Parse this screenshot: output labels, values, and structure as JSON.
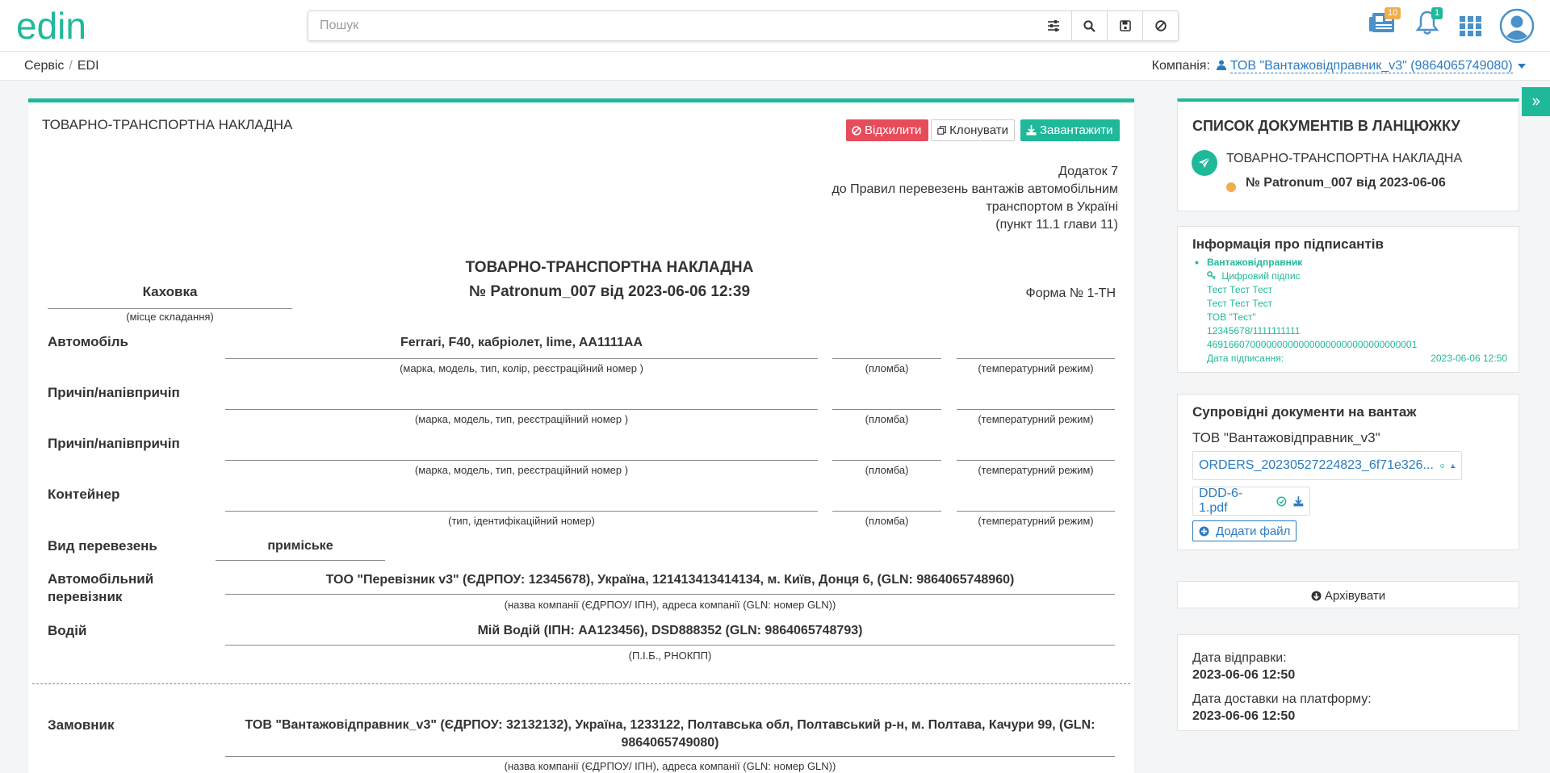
{
  "header": {
    "logo_text": "edin",
    "search_placeholder": "Пошук",
    "news_badge": "10",
    "notif_badge": "1"
  },
  "breadcrumb": [
    "Сервіс",
    "EDI"
  ],
  "company": {
    "label": "Компанія:",
    "name": "ТОВ \"Вантажовідправник_v3\" (9864065749080)"
  },
  "card": {
    "title": "ТОВАРНО-ТРАНСПОРТНА НАКЛАДНА",
    "reject_label": "Відхилити",
    "clone_label": "Клонувати",
    "download_label": "Завантажити"
  },
  "doc": {
    "appendix": [
      "Додаток 7",
      "до Правил перевезень вантажів автомобільним",
      "транспортом в Україні",
      "(пункт 11.1 глави 11)"
    ],
    "title": "ТОВАРНО-ТРАНСПОРТНА НАКЛАДНА",
    "number": "№ Patronum_007 від 2023-06-06 12:39",
    "place": "Каховка",
    "place_caption": "(місце складання)",
    "form_no": "Форма № 1-ТН",
    "car_label": "Автомобіль",
    "car_value": "Ferrari, F40, кабріолет, lime, AA1111AA",
    "car_caption": "(марка, модель, тип, колір, реєстраційний номер )",
    "seal_caption": "(пломба)",
    "temp_caption": "(температурний режим)",
    "trailer_label": "Причіп/напівпричіп",
    "trailer_caption": "(марка, модель, тип, реєстраційний номер )",
    "container_label": "Контейнер",
    "container_caption": "(тип, ідентифікаційний номер)",
    "transport_type_label": "Вид перевезень",
    "transport_type_value": "приміське",
    "carrier_label": "Автомобільний перевізник",
    "carrier_value": "ТОО \"Перевізник v3\" (ЄДРПОУ: 12345678), Україна, 121413413414134, м. Київ, Донця 6, (GLN: 9864065748960)",
    "company_caption": "(назва компанії (ЄДРПОУ/ ІПН), адреса компанії (GLN: номер GLN))",
    "driver_label": "Водій",
    "driver_value": "Мій Водій (ІПН: АА123456), DSD888352 (GLN: 9864065748793)",
    "driver_caption": "(П.І.Б., РНОКПП)",
    "customer_label": "Замовник",
    "customer_value": "ТОВ \"Вантажовідправник_v3\" (ЄДРПОУ: 32132132), Україна, 1233122, Полтавська обл, Полтавський р-н, м. Полтава, Качури 99, (GLN: 9864065749080)"
  },
  "sidebar": {
    "chain_title": "СПИСОК ДОКУМЕНТІВ В ЛАНЦЮЖКУ",
    "chain_doc_type": "ТОВАРНО-ТРАНСПОРТНА НАКЛАДНА",
    "chain_doc_number": "№ Patronum_007 від 2023-06-06",
    "signers_title": "Інформація про підписантів",
    "signer_role": "Вантажовідправник",
    "signature_type": "Цифровий підпис",
    "signer_lines": [
      "Тест Тест Тест",
      "Тест Тест Тест",
      "ТОВ \"Тест\"",
      "12345678/1111111111",
      "469166070000000000000000000000000000001"
    ],
    "sign_date_label": "Дата підписання:",
    "sign_date_value": "2023-06-06 12:50",
    "accomp_title": "Супровідні документи на вантаж",
    "accomp_company": "ТОВ \"Вантажовідправник_v3\"",
    "files": [
      "ORDERS_20230527224823_6f71e326...",
      "DDD-6-1.pdf"
    ],
    "add_file_label": "Додати файл",
    "archive_label": "Архівувати",
    "sent_date_label": "Дата відправки:",
    "sent_date_value": "2023-06-06 12:50",
    "delivery_date_label": "Дата доставки на платформу:",
    "delivery_date_value": "2023-06-06 12:50"
  },
  "colors": {
    "accent": "#1fb99a",
    "danger": "#e74c5b",
    "link": "#2c7bc0",
    "warning": "#f0ad4e"
  }
}
